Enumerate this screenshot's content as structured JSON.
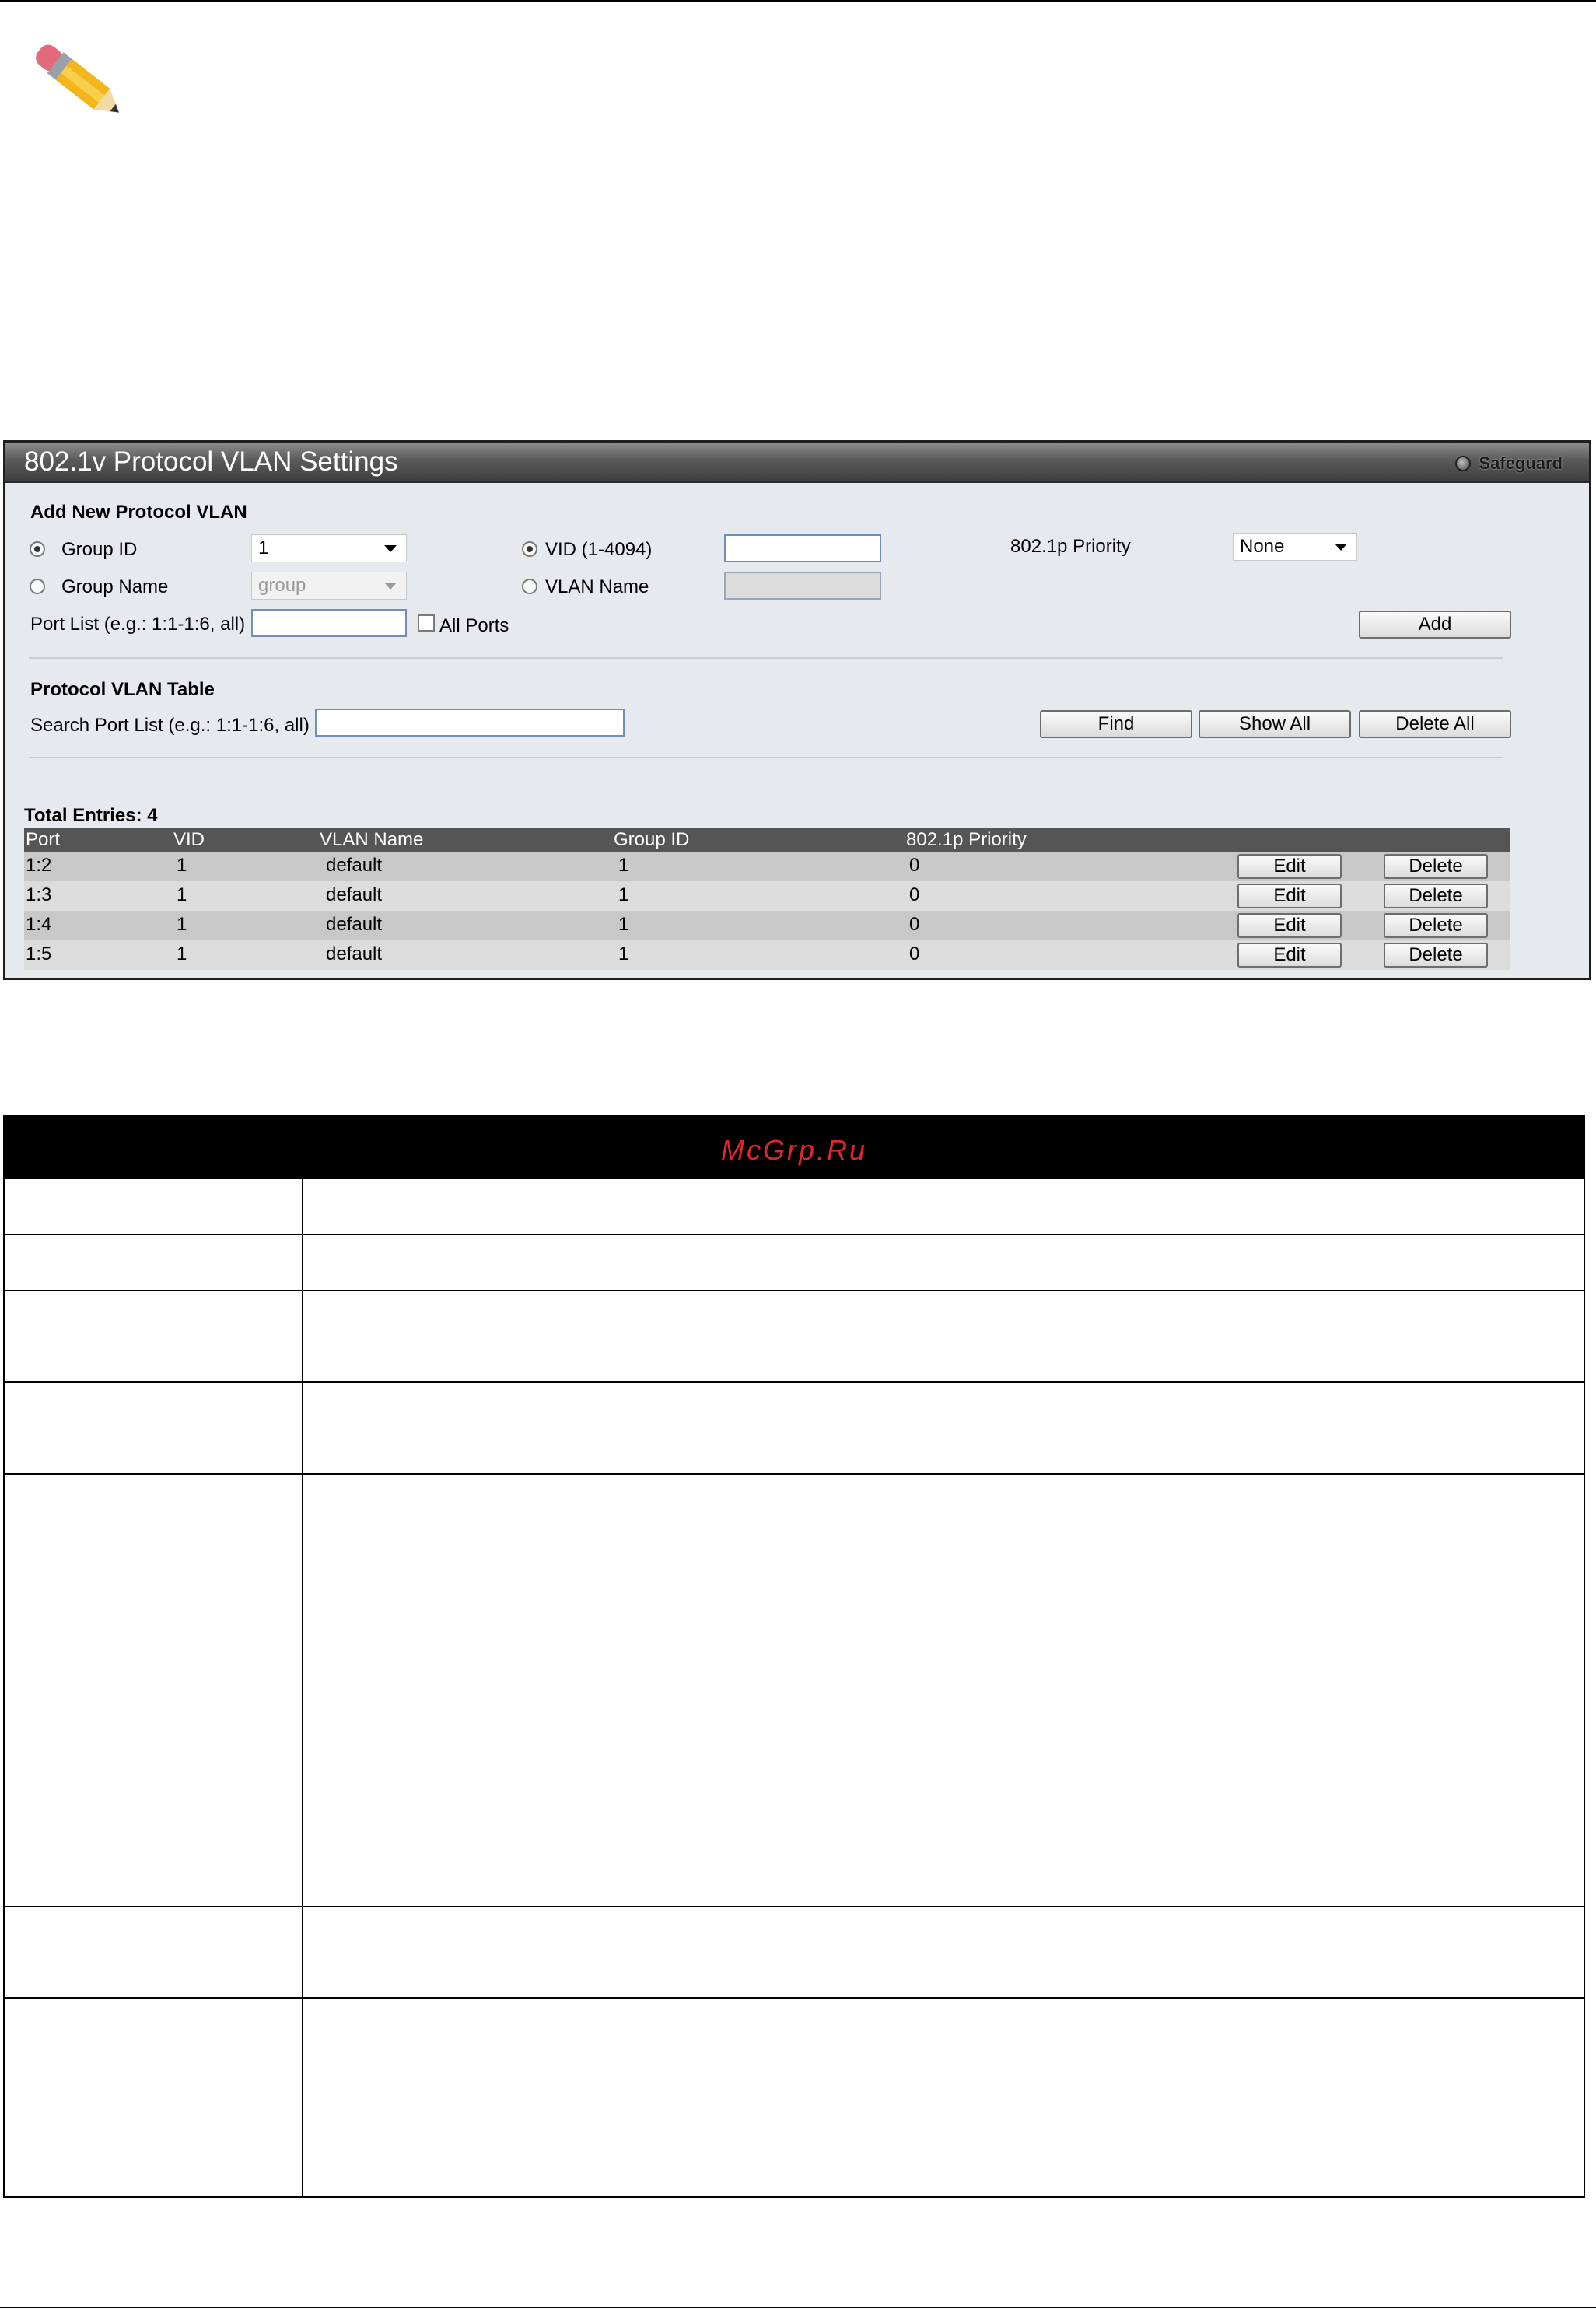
{
  "panel": {
    "title": "802.1v Protocol VLAN Settings",
    "safeguard": "Safeguard",
    "add_section": {
      "heading": "Add New Protocol VLAN",
      "group_id_label": "Group ID",
      "group_id_value": "1",
      "group_name_label": "Group Name",
      "group_name_value": "group",
      "vid_label": "VID (1-4094)",
      "vid_value": "",
      "vlan_name_label": "VLAN Name",
      "vlan_name_value": "",
      "priority_label": "802.1p Priority",
      "priority_value": "None",
      "port_list_label": "Port List (e.g.: 1:1-1:6, all)",
      "port_list_value": "",
      "all_ports_label": "All Ports",
      "add_button": "Add"
    },
    "table_section": {
      "heading": "Protocol VLAN Table",
      "search_label": "Search Port List (e.g.: 1:1-1:6, all)",
      "search_value": "",
      "find_button": "Find",
      "show_all_button": "Show All",
      "delete_all_button": "Delete All"
    },
    "total_entries": "Total Entries: 4",
    "columns": [
      "Port",
      "VID",
      "VLAN Name",
      "Group ID",
      "802.1p Priority"
    ],
    "rows": [
      {
        "port": "1:2",
        "vid": "1",
        "vlan_name": "default",
        "group_id": "1",
        "priority": "0"
      },
      {
        "port": "1:3",
        "vid": "1",
        "vlan_name": "default",
        "group_id": "1",
        "priority": "0"
      },
      {
        "port": "1:4",
        "vid": "1",
        "vlan_name": "default",
        "group_id": "1",
        "priority": "0"
      },
      {
        "port": "1:5",
        "vid": "1",
        "vlan_name": "default",
        "group_id": "1",
        "priority": "0"
      }
    ],
    "edit_button": "Edit",
    "delete_button": "Delete"
  },
  "doc_table": {
    "watermark": "McGrp.Ru"
  }
}
